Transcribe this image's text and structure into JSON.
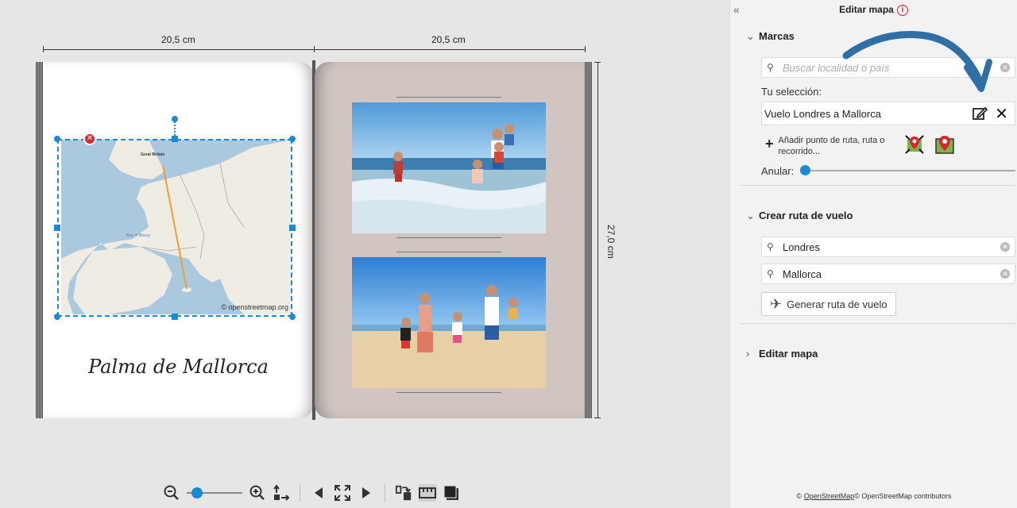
{
  "canvas": {
    "width_label_left": "20,5 cm",
    "width_label_right": "20,5 cm",
    "height_label": "27,0 cm",
    "left_page_title": "Palma de Mallorca",
    "map_attribution": "© openstreetmap.org",
    "map_tiny_label": "Great Britain",
    "map_tiny_label2": "Bay of Biscay"
  },
  "toolbar": {
    "zoom_out": "zoom-out-icon",
    "zoom_in": "zoom-in-icon",
    "zoom_level": 0.1
  },
  "panel": {
    "title": "Editar mapa",
    "collapse": "«",
    "info": "i",
    "marcas": {
      "heading": "Marcas",
      "search_placeholder": "Buscar localidad o país",
      "selection_label": "Tu selección:",
      "selection_value": "Vuelo Londres a Mallorca",
      "add_text": "Añadir punto de ruta, ruta o recorrido...",
      "anular_label": "Anular:",
      "anular_value": 0
    },
    "vuelo": {
      "heading": "Crear ruta de vuelo",
      "from_value": "Londres",
      "to_value": "Mallorca",
      "generate_button": "Generar ruta de vuelo"
    },
    "editar": {
      "heading": "Editar mapa"
    },
    "footer_prefix": "©",
    "footer_link": "OpenStreetMap",
    "footer_suffix": "© OpenStreetMap contributors"
  },
  "colors": {
    "accent": "#1a8ad4",
    "danger": "#d9252b",
    "annotation_arrow": "#2e6fa6"
  }
}
